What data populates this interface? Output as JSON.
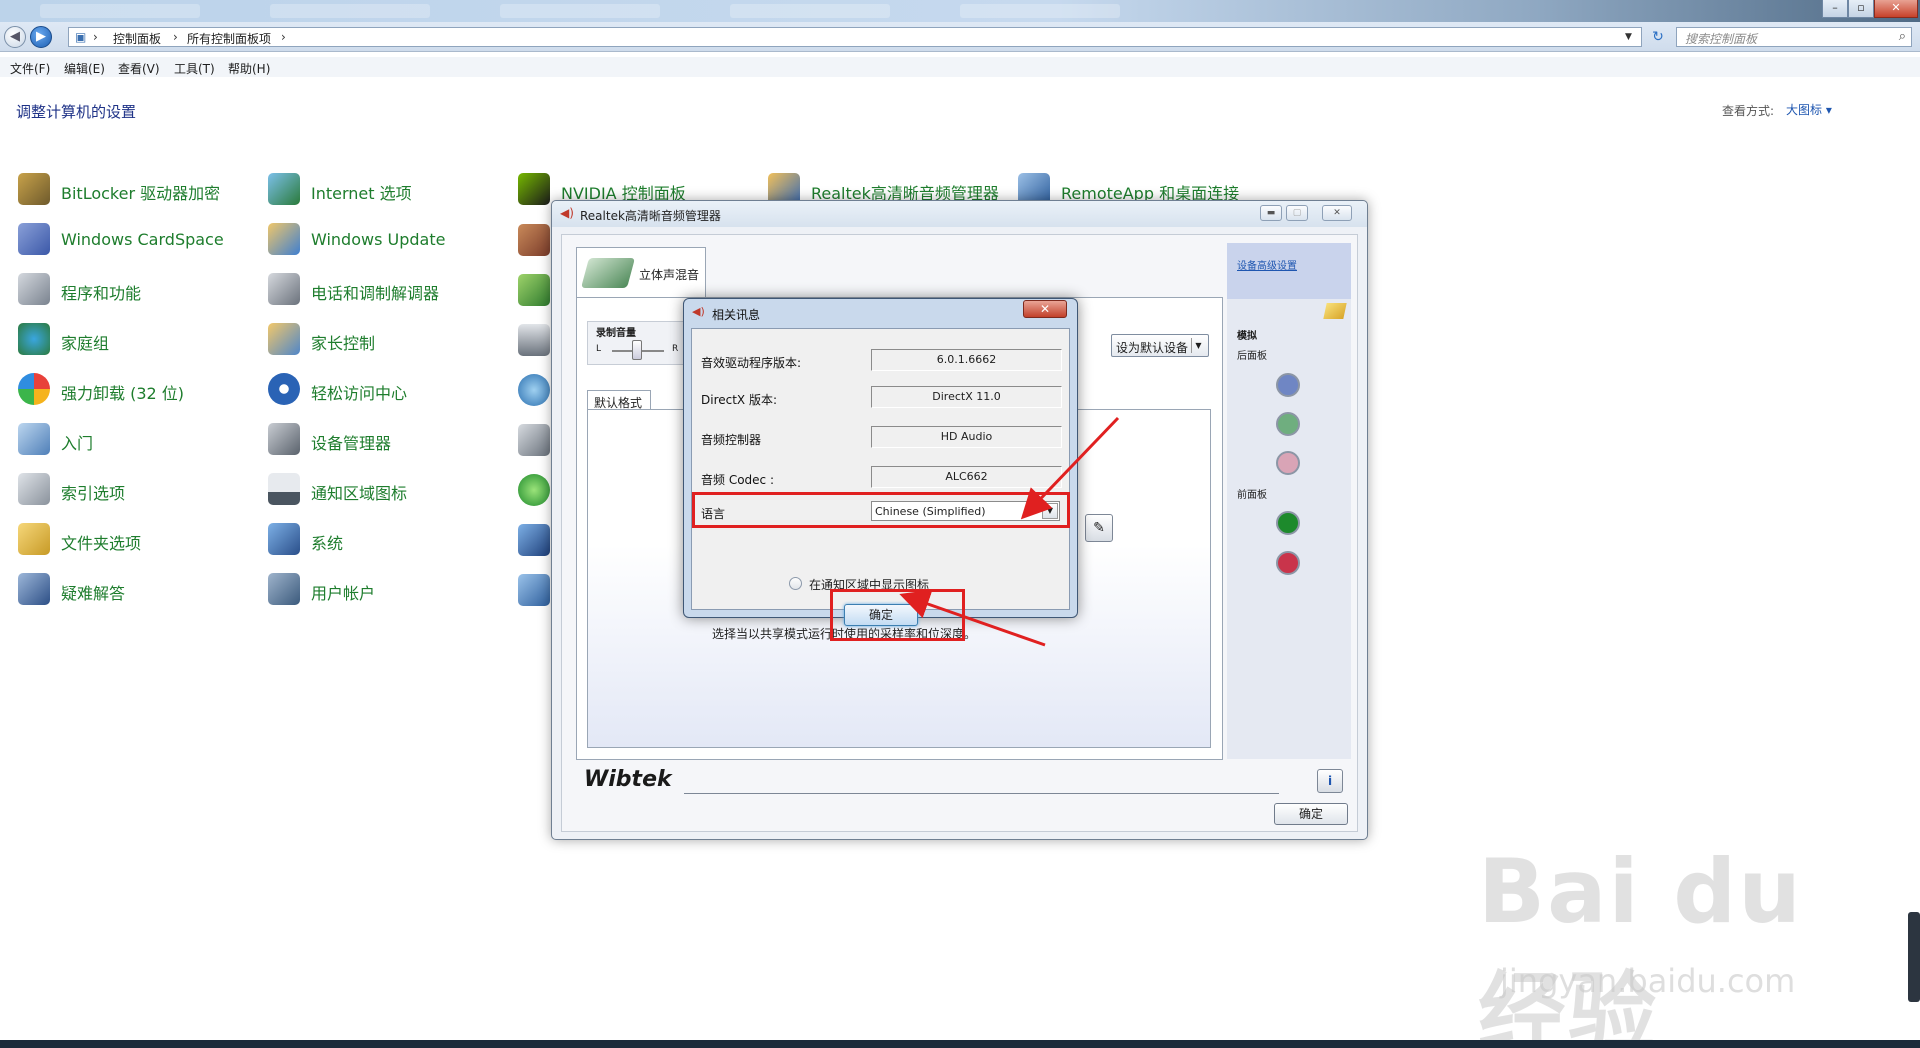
{
  "titlebar": {
    "caption_buttons": {
      "minimize": "–",
      "maximize": "▫",
      "close": "✕"
    }
  },
  "address_bar": {
    "back_icon": "back-arrow-icon",
    "forward_icon": "forward-arrow-icon",
    "crumbs": [
      "控制面板",
      "所有控制面板项"
    ],
    "search_placeholder": "搜索控制面板"
  },
  "menu": [
    "文件(F)",
    "编辑(E)",
    "查看(V)",
    "工具(T)",
    "帮助(H)"
  ],
  "page": {
    "title": "调整计算机的设置",
    "view_by_label": "查看方式:",
    "view_by_value": "大图标 ▾"
  },
  "control_panel": {
    "col1": [
      "BitLocker 驱动器加密",
      "Windows CardSpace",
      "程序和功能",
      "家庭组",
      "强力卸载 (32 位)",
      "入门",
      "索引选项",
      "文件夹选项",
      "疑难解答"
    ],
    "col2": [
      "Internet 选项",
      "Windows Update",
      "电话和调制解调器",
      "家长控制",
      "轻松访问中心",
      "设备管理器",
      "通知区域图标",
      "系统",
      "用户帐户"
    ],
    "top_row": [
      "NVIDIA 控制面板",
      "Realtek高清晰音频管理器",
      "RemoteApp 和桌面连接"
    ]
  },
  "realtek": {
    "title": "Realtek高清晰音频管理器",
    "tab_stereo": "立体声混音",
    "recording_volume": "录制音量",
    "left": "L",
    "right": "R",
    "set_default": "设为默认设备",
    "inner_tab": "默认格式",
    "description": "选择当以共享模式运行时使用的采样率和位深度。",
    "advanced_settings": "设备高级设置",
    "analog": "模拟",
    "rear_panel": "后面板",
    "front_panel": "前面板",
    "brand": "Wibtek",
    "ok": "确定",
    "jack_colors": [
      "#6f86c4",
      "#6fae7f",
      "#d9a4b6",
      "#1d8a2c",
      "#c9344b"
    ]
  },
  "dialog": {
    "title": "相关讯息",
    "close": "✕",
    "rows": [
      {
        "label": "音效驱动程序版本:",
        "value": "6.0.1.6662"
      },
      {
        "label": "DirectX 版本:",
        "value": "DirectX 11.0"
      },
      {
        "label": "音频控制器",
        "value": "HD Audio"
      },
      {
        "label": "音频 Codec :",
        "value": "ALC662"
      }
    ],
    "language_label": "语言",
    "language_value": "Chinese (Simplified)",
    "tray_label": "在通知区域中显示图标",
    "ok": "确定"
  },
  "watermark": {
    "logo": "Bai du 经验",
    "url": "jingyan.baidu.com"
  }
}
